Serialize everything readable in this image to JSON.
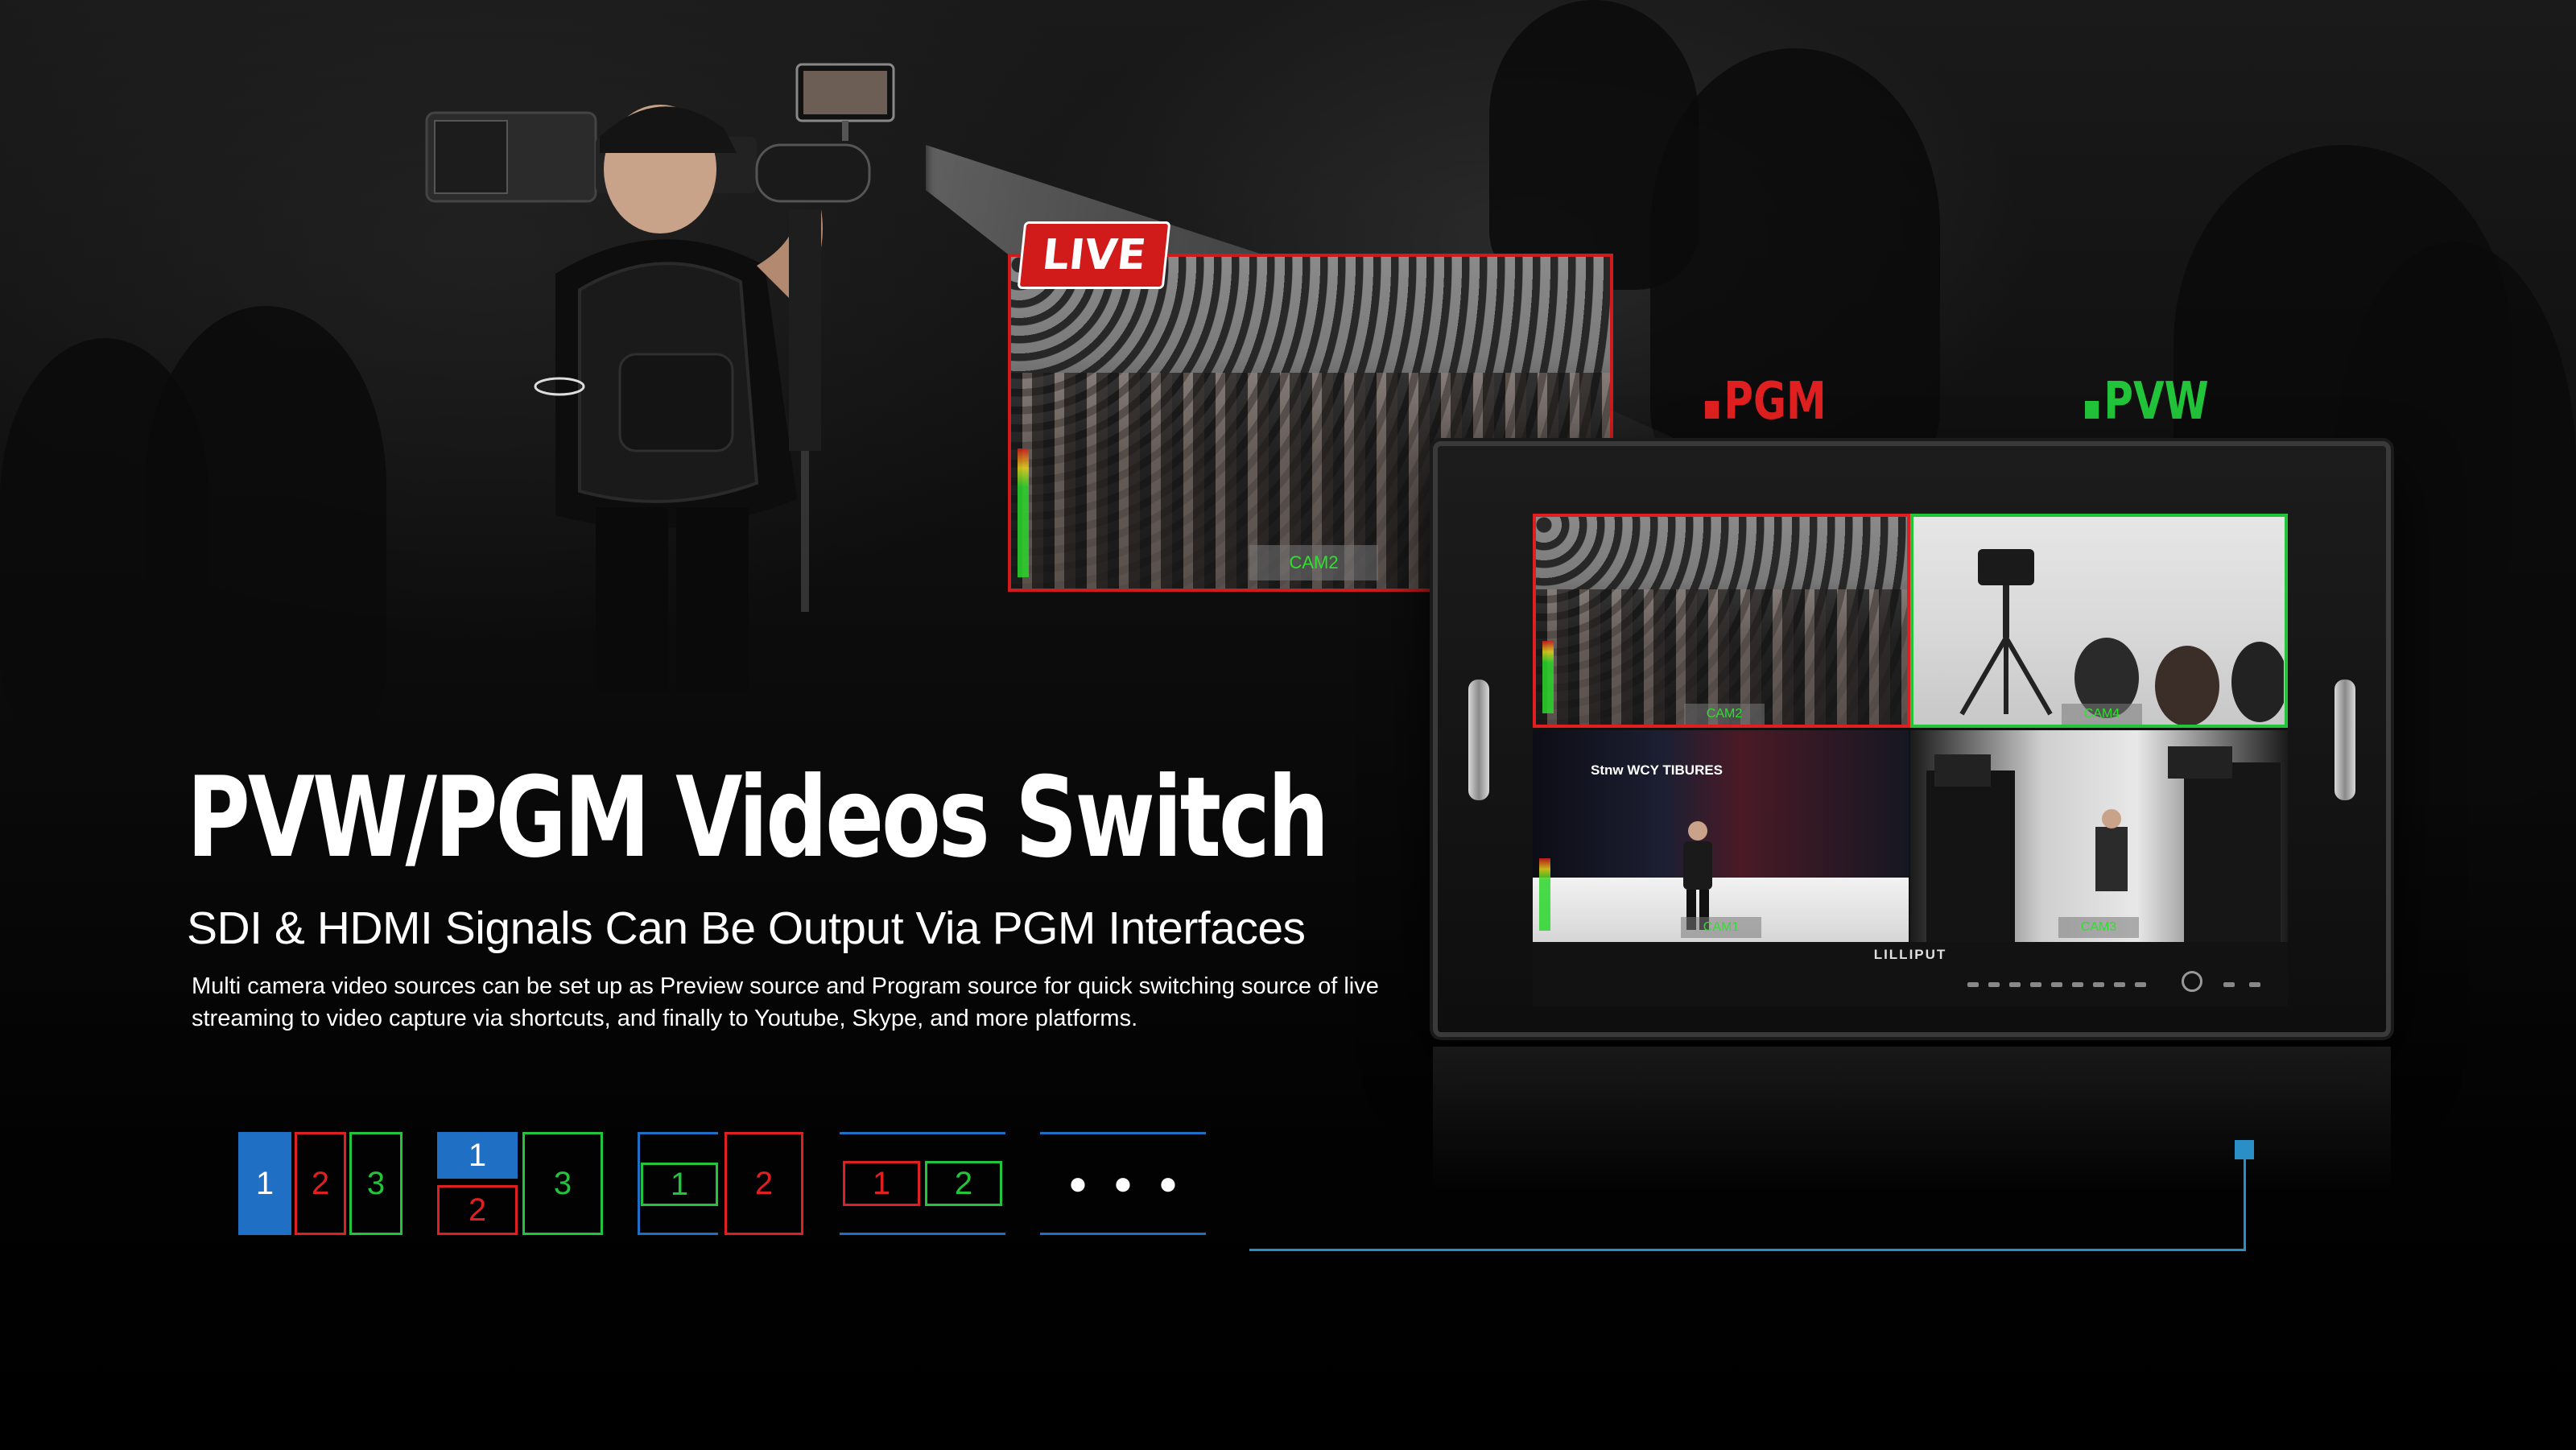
{
  "headline": "PVW/PGM Videos Switch",
  "subheadline": "SDI & HDMI Signals Can Be Output Via PGM Interfaces",
  "description": "Multi camera video sources can be set up as Preview source and Program source for quick switching source of live streaming to video capture via shortcuts, and finally to Youtube, Skype, and more platforms.",
  "live_feed": {
    "badge": "LIVE",
    "camera_label": "CAM2"
  },
  "monitor": {
    "brand": "LILLIPUT",
    "pgm_tag": "PGM",
    "pvw_tag": "PVW",
    "quads": [
      {
        "label": "CAM2",
        "scene": "crowd",
        "status": "pgm"
      },
      {
        "label": "CAM4",
        "scene": "studio",
        "status": "pvw"
      },
      {
        "label": "CAM1",
        "scene": "stage",
        "status": "none",
        "screen_text": "Stnw WCY TIBURES"
      },
      {
        "label": "CAM3",
        "scene": "side",
        "status": "none"
      }
    ]
  },
  "layout_icons": [
    {
      "cells": [
        "1",
        "2",
        "3"
      ]
    },
    {
      "cells": [
        "1",
        "2",
        "3"
      ]
    },
    {
      "cells": [
        "1",
        "2"
      ]
    },
    {
      "cells": [
        "1",
        "2"
      ]
    },
    {
      "cells": [
        "●",
        "●",
        "●"
      ]
    }
  ],
  "colors": {
    "pgm": "#e02020",
    "pvw": "#22c43a",
    "selected": "#1f6fc5",
    "wire": "#2a8fc7",
    "live": "#d11a1a"
  }
}
